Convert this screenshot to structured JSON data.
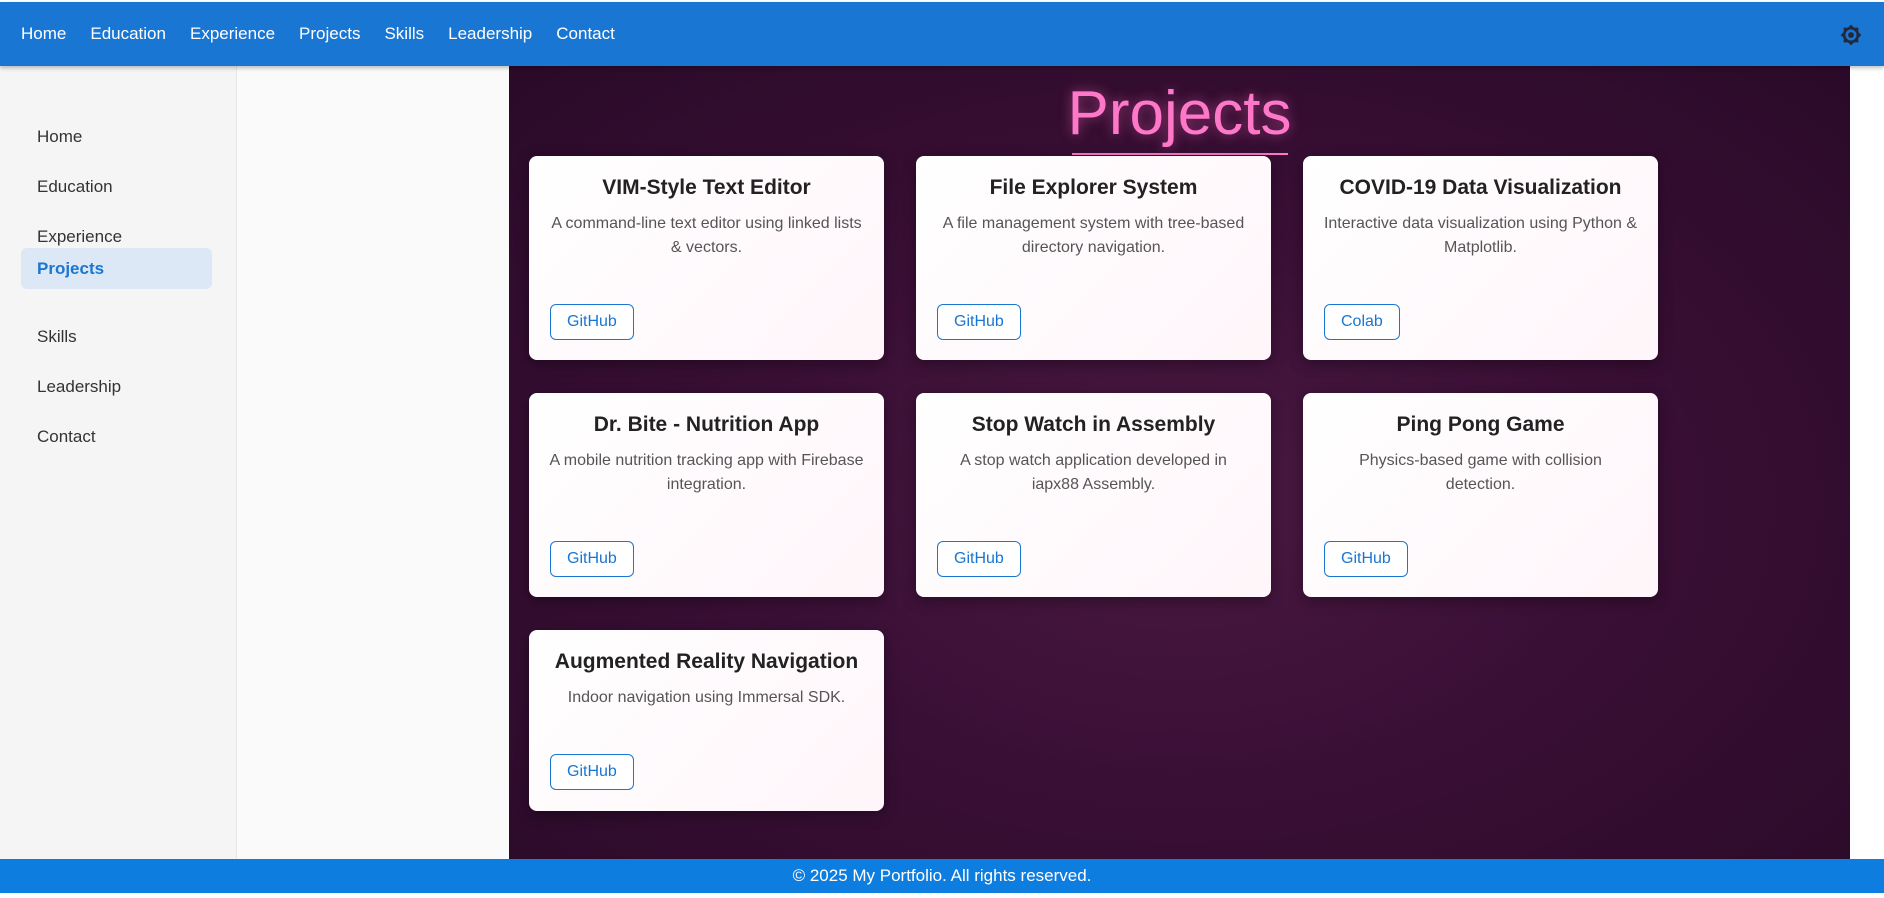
{
  "topnav": {
    "items": [
      "Home",
      "Education",
      "Experience",
      "Projects",
      "Skills",
      "Leadership",
      "Contact"
    ],
    "theme_icon": "brightness-icon"
  },
  "sidebar": {
    "items": [
      "Home",
      "Education",
      "Experience",
      "Projects",
      "Skills",
      "Leadership",
      "Contact"
    ],
    "active": "Projects"
  },
  "main": {
    "title": "Projects",
    "projects": [
      {
        "title": "VIM-Style Text Editor",
        "description": "A command-line text editor using linked lists & vectors.",
        "button": "GitHub"
      },
      {
        "title": "File Explorer System",
        "description": "A file management system with tree-based directory navigation.",
        "button": "GitHub"
      },
      {
        "title": "COVID-19 Data Visualization",
        "description": "Interactive data visualization using Python & Matplotlib.",
        "button": "Colab"
      },
      {
        "title": "Dr. Bite - Nutrition App",
        "description": "A mobile nutrition tracking app with Firebase integration.",
        "button": "GitHub"
      },
      {
        "title": "Stop Watch in Assembly",
        "description": "A stop watch application developed in iapx88 Assembly.",
        "button": "GitHub"
      },
      {
        "title": "Ping Pong Game",
        "description": "Physics-based game with collision detection.",
        "button": "GitHub"
      },
      {
        "title": "Augmented Reality Navigation",
        "description": "Indoor navigation using Immersal SDK.",
        "button": "GitHub"
      }
    ]
  },
  "footer": {
    "text": "© 2025 My Portfolio. All rights reserved."
  },
  "colors": {
    "primary": "#1976d2",
    "accent_pink": "#ff77c8",
    "main_bg": "#3a0f36",
    "footer_bg": "#0e7de0"
  }
}
